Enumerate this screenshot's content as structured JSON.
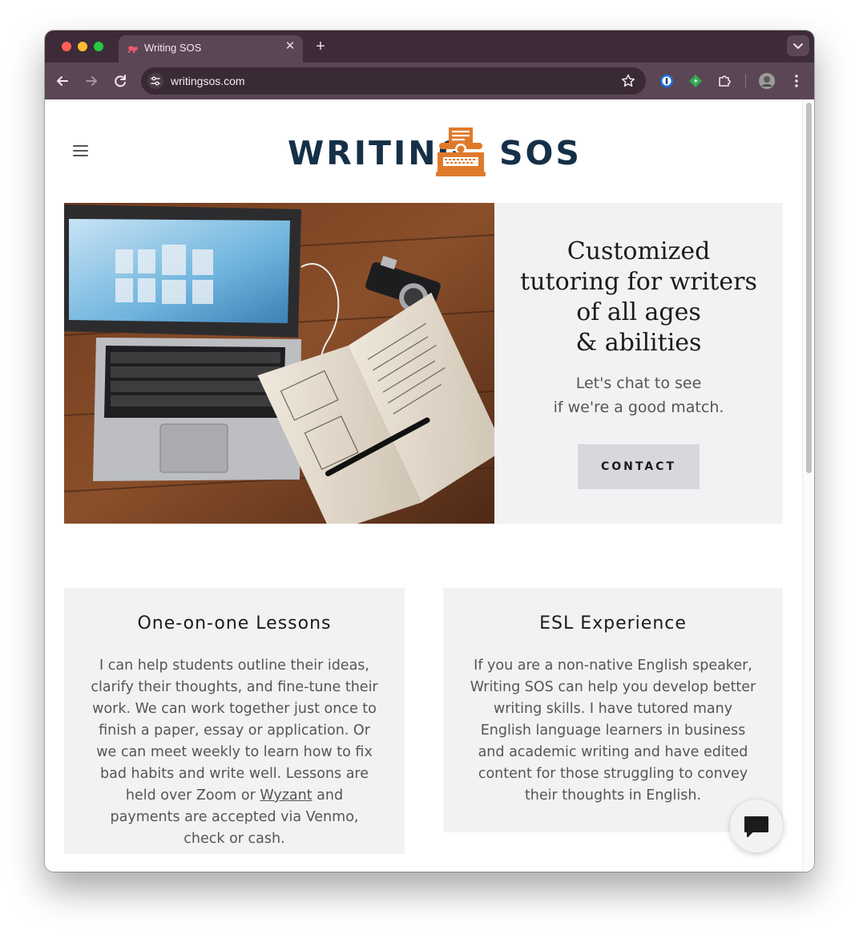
{
  "browser": {
    "tab_title": "Writing SOS",
    "tab_close": "✕",
    "new_tab": "+",
    "url": "writingsos.com"
  },
  "site": {
    "logo_left": "WRITING",
    "logo_right": "SOS"
  },
  "hero": {
    "title_lines": [
      "Customized",
      "tutoring for writers",
      "of all ages",
      "& abilities"
    ],
    "subtitle_lines": [
      "Let's chat to see",
      "if we're a good match."
    ],
    "button_label": "CONTACT"
  },
  "cards": [
    {
      "title": "One-on-one Lessons",
      "body_before_link": "I can help students outline their ideas, clarify their thoughts, and fine-tune their work. We can work together just once to finish a paper, essay or application. Or we can meet weekly to learn how to fix bad habits and write well. Lessons are held over Zoom or ",
      "link_text": "Wyzant",
      "body_after_link": " and payments are accepted via Venmo, check or cash."
    },
    {
      "title": "ESL Experience",
      "body": "If you are a non-native English speaker, Writing SOS can help you develop better writing skills. I have tutored many English language learners in business and academic writing and have edited content for those struggling to convey their thoughts in English."
    }
  ],
  "colors": {
    "logo_navy": "#153047",
    "logo_orange": "#e07a2b",
    "panel_bg": "#f1f2f4",
    "button_bg": "#d7d8db",
    "chrome_frame": "#3d2b39",
    "chrome_toolbar": "#5a4654"
  },
  "icons": [
    "back-icon",
    "forward-icon",
    "reload-icon",
    "site-settings-icon",
    "star-icon",
    "password-manager-icon",
    "extension-icon",
    "puzzle-icon",
    "profile-avatar",
    "more-icon",
    "hamburger-icon",
    "typewriter-icon",
    "chat-icon"
  ]
}
